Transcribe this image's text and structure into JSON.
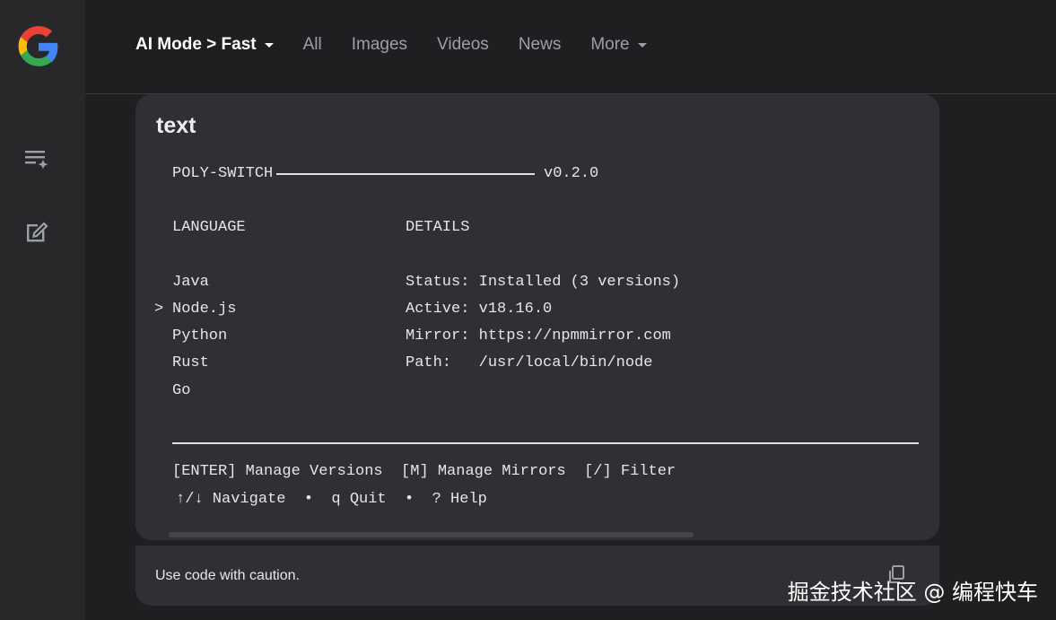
{
  "sidebar": {
    "logo": "google-logo",
    "icons": [
      "ai-search-history-icon",
      "new-chat-icon"
    ]
  },
  "topbar": {
    "tabs": [
      {
        "label": "AI Mode > Fast",
        "active": true,
        "dropdown": true
      },
      {
        "label": "All"
      },
      {
        "label": "Images"
      },
      {
        "label": "Videos"
      },
      {
        "label": "News"
      },
      {
        "label": "More",
        "dropdown": true
      }
    ]
  },
  "code_block": {
    "language_label": "text",
    "header_left": "POLY-SWITCH",
    "header_right": "v0.2.0",
    "col_language": "LANGUAGE",
    "col_details": "DETAILS",
    "languages": [
      "Java",
      "Node.js",
      "Python",
      "Rust",
      "Go"
    ],
    "selected_marker": ">",
    "details": [
      "Status: Installed (3 versions)",
      "Active: v18.16.0",
      "Mirror: https://npmmirror.com",
      "Path:   /usr/local/bin/node"
    ],
    "keys_line1": "[ENTER] Manage Versions  [M] Manage Mirrors  [/] Filter",
    "keys_line2": "↑/↓ Navigate  •  q Quit  •  ? Help"
  },
  "footer": {
    "caution_text": "Use code with caution."
  },
  "watermark": "掘金技术社区 @ 编程快车",
  "colors": {
    "background": "#1f1f21",
    "sidebar": "#28282b",
    "card": "#303034"
  }
}
